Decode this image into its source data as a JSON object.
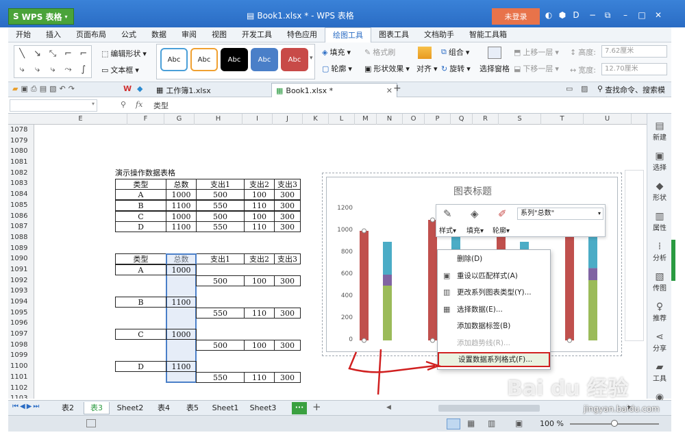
{
  "app": {
    "name": "WPS 表格",
    "window_title": "Book1.xlsx * - WPS 表格",
    "login": "未登录"
  },
  "menu": [
    "开始",
    "插入",
    "页面布局",
    "公式",
    "数据",
    "审阅",
    "视图",
    "开发工具",
    "特色应用",
    "绘图工具",
    "图表工具",
    "文档助手",
    "智能工具箱"
  ],
  "ribbon": {
    "edit_shape": "编辑形状",
    "textbox": "文本框",
    "styles": [
      "Abc",
      "Abc",
      "Abc",
      "Abc",
      "Abc"
    ],
    "fill": "填充",
    "format_brush": "格式刷",
    "outline": "轮廓",
    "shape_effect": "形状效果",
    "align": "对齐",
    "combine": "组合",
    "rotate": "旋转",
    "select_pane": "选择窗格",
    "bring_forward": "上移一层",
    "send_backward": "下移一层",
    "height_label": "高度:",
    "height_value": "7.62厘米",
    "width_label": "宽度:",
    "width_value": "12.70厘米"
  },
  "doc_tabs": [
    "工作簿1.xlsx",
    "Book1.xlsx *"
  ],
  "search_label": "查找命令、搜索模板",
  "formula": {
    "content": "类型"
  },
  "columns": [
    "E",
    "F",
    "G",
    "H",
    "I",
    "J",
    "K",
    "L",
    "M",
    "N",
    "O",
    "P",
    "Q",
    "R",
    "S",
    "T",
    "U"
  ],
  "rows": [
    "1078",
    "1079",
    "1080",
    "1081",
    "1082",
    "1083",
    "1084",
    "1085",
    "1086",
    "1087",
    "1088",
    "1089",
    "1090",
    "1091",
    "1092",
    "1093",
    "1094",
    "1095",
    "1096",
    "1097",
    "1098",
    "1099",
    "1100",
    "1101",
    "1102",
    "1103"
  ],
  "table1": {
    "title": "演示操作数据表格",
    "header": [
      "类型",
      "总数",
      "支出1",
      "支出2",
      "支出3"
    ],
    "rows": [
      [
        "A",
        "1000",
        "500",
        "100",
        "300"
      ],
      [
        "B",
        "1100",
        "550",
        "110",
        "300"
      ],
      [
        "C",
        "1000",
        "500",
        "100",
        "300"
      ],
      [
        "D",
        "1100",
        "550",
        "110",
        "300"
      ]
    ]
  },
  "table2": {
    "header": [
      "类型",
      "总数",
      "支出1",
      "支出2",
      "支出3"
    ],
    "groups": [
      {
        "type": "A",
        "total": "1000",
        "e1": "500",
        "e2": "100",
        "e3": "300"
      },
      {
        "type": "B",
        "total": "1100",
        "e1": "550",
        "e2": "110",
        "e3": "300"
      },
      {
        "type": "C",
        "total": "1000",
        "e1": "500",
        "e2": "100",
        "e3": "300"
      },
      {
        "type": "D",
        "total": "1100",
        "e1": "550",
        "e2": "110",
        "e3": "300"
      }
    ]
  },
  "chart_data": {
    "type": "bar",
    "title": "图表标题",
    "ylim": [
      0,
      1200
    ],
    "yticks": [
      "1200",
      "1000",
      "800",
      "600",
      "400",
      "200",
      "0"
    ],
    "series": [
      {
        "name": "总数",
        "values": [
          1000,
          1100,
          1000,
          1100
        ],
        "color": "#c0504d"
      },
      {
        "name": "支出1",
        "values": [
          500,
          550,
          500,
          550
        ],
        "color": "#9bbb59"
      },
      {
        "name": "支出2",
        "values": [
          100,
          110,
          100,
          110
        ],
        "color": "#8064a2"
      },
      {
        "name": "支出3",
        "values": [
          300,
          300,
          300,
          300
        ],
        "color": "#4bacc6"
      }
    ]
  },
  "mini_toolbar": {
    "series_select": "系列\"总数\"",
    "style": "样式",
    "fill": "填充",
    "outline": "轮廓"
  },
  "context_menu": [
    {
      "label": "删除(D)",
      "disabled": false
    },
    {
      "label": "重设以匹配样式(A)",
      "disabled": false
    },
    {
      "label": "更改系列图表类型(Y)...",
      "disabled": false
    },
    {
      "label": "选择数据(E)...",
      "disabled": false
    },
    {
      "label": "添加数据标签(B)",
      "disabled": false
    },
    {
      "label": "添加趋势线(R)...",
      "disabled": true
    },
    {
      "label": "设置数据系列格式(F)...",
      "disabled": false
    }
  ],
  "sidebar": [
    "新建",
    "选择",
    "形状",
    "属性",
    "分析",
    "传图",
    "推荐",
    "分享",
    "工具",
    "备份"
  ],
  "sheets": [
    "表2",
    "表3",
    "Sheet2",
    "表4",
    "表5",
    "Sheet1",
    "Sheet3"
  ],
  "status": {
    "zoom": "100 %"
  },
  "watermark": {
    "brand": "Bai du 经验",
    "url": "jingyan.baidu.com"
  }
}
